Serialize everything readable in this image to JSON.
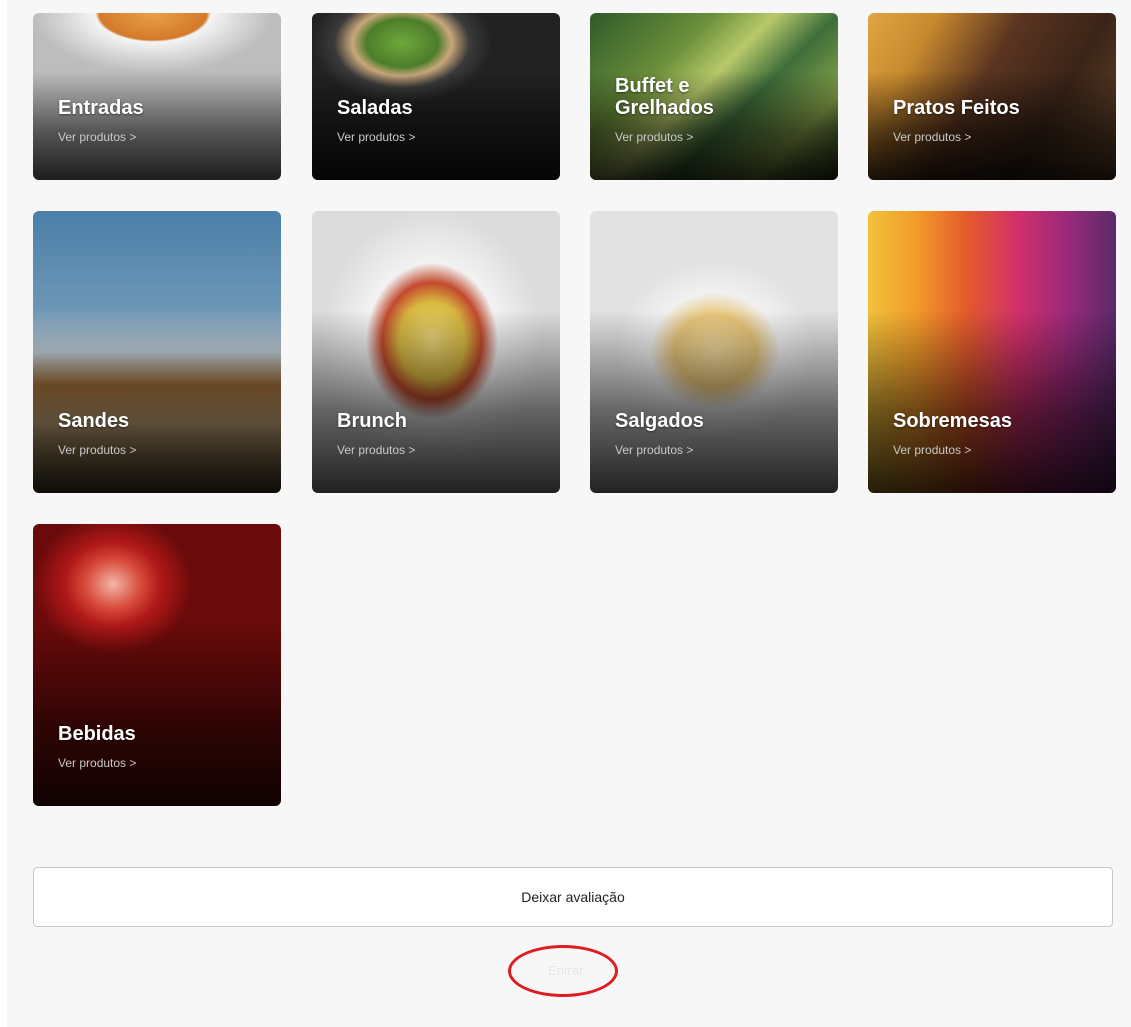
{
  "colors": {
    "page_bg": "#f7f7f7",
    "title_text": "#ffffff",
    "link_text": "#c9c9c9",
    "annotation_red": "#e01b22",
    "login_text": "#e6e6e6"
  },
  "categories": [
    {
      "title": "Entradas",
      "link": "Ver produtos >"
    },
    {
      "title": "Saladas",
      "link": "Ver produtos >"
    },
    {
      "title": "Buffet e Grelhados",
      "link": "Ver produtos >"
    },
    {
      "title": "Pratos Feitos",
      "link": "Ver produtos >"
    },
    {
      "title": "Sandes",
      "link": "Ver produtos >"
    },
    {
      "title": "Brunch",
      "link": "Ver produtos >"
    },
    {
      "title": "Salgados",
      "link": "Ver produtos >"
    },
    {
      "title": "Sobremesas",
      "link": "Ver produtos >"
    },
    {
      "title": "Bebidas",
      "link": "Ver produtos >"
    }
  ],
  "footer": {
    "review_label": "Deixar avaliação",
    "login_label": "Entrar"
  }
}
